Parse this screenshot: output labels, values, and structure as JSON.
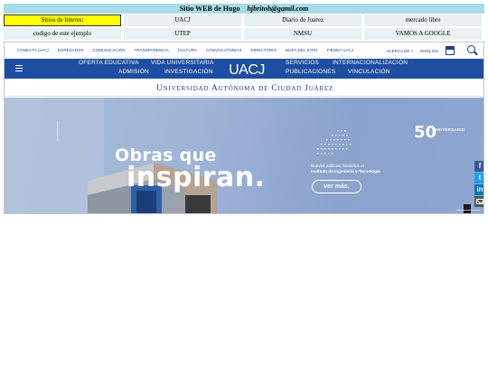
{
  "header": {
    "title": "Sitio WEB de Hugo",
    "email": "hjbritoh@gamil.com"
  },
  "links": {
    "row1": [
      "Sitios de Interes:",
      "UACJ",
      "Diario de Juarez",
      "mercado libre"
    ],
    "row2": [
      "codigo de este ejemplo",
      "UTEP",
      "NMSU",
      "VAMOS A GOOGLE"
    ]
  },
  "uacj": {
    "utility_links": [
      "CONECTA UACJ",
      "EGRESADOS",
      "COMUNICACIÓN",
      "TRANSPARENCIA",
      "CULTURA",
      "CONVOCATORIAS",
      "DIRECTORIO",
      "MAPA DEL SITIO",
      "TIENDA UACJ"
    ],
    "about_label": "ACERCA DE ˅",
    "language_label": "ENGLISH",
    "logo": "UACJ",
    "nav_left_top": [
      "OFERTA EDUCATIVA",
      "VIDA UNIVERSITARIA"
    ],
    "nav_left_bottom": [
      "ADMISIÓN",
      "INVESTIGACIÓN"
    ],
    "nav_right_top": [
      "SERVICIOS",
      "INTERNACIONALIZACIÓN"
    ],
    "nav_right_bottom": [
      "PUBLICACIONES",
      "VINCULACIÓN"
    ],
    "university_name": "Universidad Autónoma de Ciudad Juárez",
    "hero": {
      "title_line1": "Obras que",
      "title_line2": "inspiran.",
      "caption_line1": "Nuevos edificios liviatorios el",
      "caption_line2": "Instituto de Ingeniería y Tecnología",
      "button_label": "ver más.",
      "anniversary_number": "50",
      "anniversary_label": "ANIVERSARIO"
    },
    "social": {
      "facebook": "f",
      "twitter": "t",
      "linkedin": "in"
    },
    "colors": {
      "primary_blue": "#1e4ea1",
      "title_bar": "#a8dce8",
      "highlight": "#ffff00"
    }
  }
}
